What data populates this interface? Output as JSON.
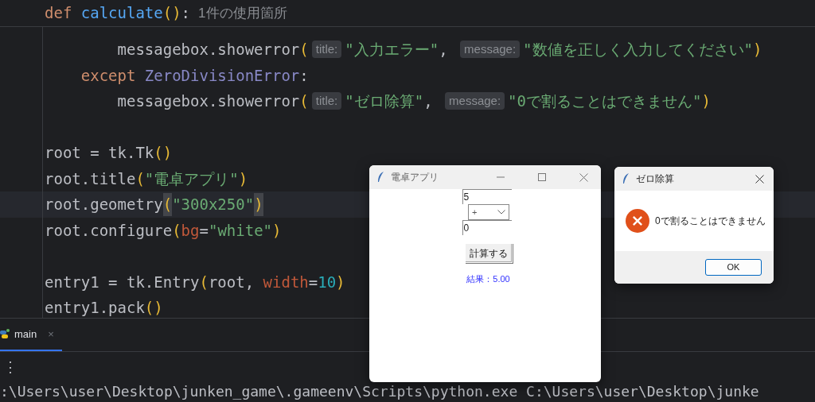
{
  "editor": {
    "sticky_header": [
      {
        "kind": "keyword",
        "text": "def "
      },
      {
        "kind": "function",
        "text": "calculate"
      },
      {
        "kind": "paren",
        "text": "()"
      },
      {
        "kind": "text",
        "text": ":"
      },
      {
        "kind": "usage",
        "text": "1件の使用箇所"
      }
    ],
    "lines": [
      {
        "kind": "code",
        "current": false,
        "tokens": [
          {
            "kind": "text",
            "text": "        messagebox.showerror"
          },
          {
            "kind": "paren",
            "text": "("
          },
          {
            "kind": "hint",
            "text": "title:"
          },
          {
            "kind": "string",
            "text": "\"入力エラー\""
          },
          {
            "kind": "text",
            "text": ", "
          },
          {
            "kind": "hint",
            "text": "message:"
          },
          {
            "kind": "string",
            "text": "\"数値を正しく入力してください\""
          },
          {
            "kind": "paren",
            "text": ")"
          }
        ]
      },
      {
        "kind": "code",
        "current": false,
        "tokens": [
          {
            "kind": "keyword",
            "text": "    except "
          },
          {
            "kind": "class",
            "text": "ZeroDivisionError"
          },
          {
            "kind": "text",
            "text": ":"
          }
        ]
      },
      {
        "kind": "code",
        "current": false,
        "tokens": [
          {
            "kind": "text",
            "text": "        messagebox.showerror"
          },
          {
            "kind": "paren",
            "text": "("
          },
          {
            "kind": "hint",
            "text": "title:"
          },
          {
            "kind": "string",
            "text": "\"ゼロ除算\""
          },
          {
            "kind": "text",
            "text": ", "
          },
          {
            "kind": "hint",
            "text": "message:"
          },
          {
            "kind": "string",
            "text": "\"0で割ることはできません\""
          },
          {
            "kind": "paren",
            "text": ")"
          }
        ]
      },
      {
        "kind": "blank",
        "current": false
      },
      {
        "kind": "code",
        "current": false,
        "tokens": [
          {
            "kind": "text",
            "text": "root = tk.Tk"
          },
          {
            "kind": "paren",
            "text": "()"
          }
        ]
      },
      {
        "kind": "code",
        "current": false,
        "tokens": [
          {
            "kind": "text",
            "text": "root.title"
          },
          {
            "kind": "paren",
            "text": "("
          },
          {
            "kind": "string",
            "text": "\"電卓アプリ\""
          },
          {
            "kind": "paren",
            "text": ")"
          }
        ]
      },
      {
        "kind": "code",
        "current": true,
        "tokens": [
          {
            "kind": "text",
            "text": "root.geometry"
          },
          {
            "kind": "paren_match",
            "text": "("
          },
          {
            "kind": "string",
            "text": "\"300x250\""
          },
          {
            "kind": "paren_match",
            "text": ")"
          }
        ]
      },
      {
        "kind": "code",
        "current": false,
        "tokens": [
          {
            "kind": "text",
            "text": "root.configure"
          },
          {
            "kind": "paren",
            "text": "("
          },
          {
            "kind": "param",
            "text": "bg"
          },
          {
            "kind": "text",
            "text": "="
          },
          {
            "kind": "string",
            "text": "\"white\""
          },
          {
            "kind": "paren",
            "text": ")"
          }
        ]
      },
      {
        "kind": "blank",
        "current": false
      },
      {
        "kind": "code",
        "current": false,
        "tokens": [
          {
            "kind": "text",
            "text": "entry1 = tk.Entry"
          },
          {
            "kind": "paren",
            "text": "("
          },
          {
            "kind": "text",
            "text": "root, "
          },
          {
            "kind": "param",
            "text": "width"
          },
          {
            "kind": "text",
            "text": "="
          },
          {
            "kind": "number",
            "text": "10"
          },
          {
            "kind": "paren",
            "text": ")"
          }
        ]
      },
      {
        "kind": "code",
        "current": false,
        "tokens": [
          {
            "kind": "text",
            "text": "entry1.pack"
          },
          {
            "kind": "paren",
            "text": "()"
          }
        ]
      }
    ]
  },
  "run_panel": {
    "tabs": [
      {
        "label": "main",
        "selected": true,
        "close": "×"
      }
    ],
    "menu": "⋮",
    "console_line": ":\\Users\\user\\Desktop\\junken_game\\.gameenv\\Scripts\\python.exe C:\\Users\\user\\Desktop\\junke"
  },
  "calculator_window": {
    "title": "電卓アプリ",
    "entry1": "5",
    "operator": "+",
    "entry2": "0",
    "button": "計算する",
    "result": "結果：5.00"
  },
  "error_dialog": {
    "title": "ゼロ除算",
    "message": "0で割ることはできません",
    "button": "OK"
  }
}
